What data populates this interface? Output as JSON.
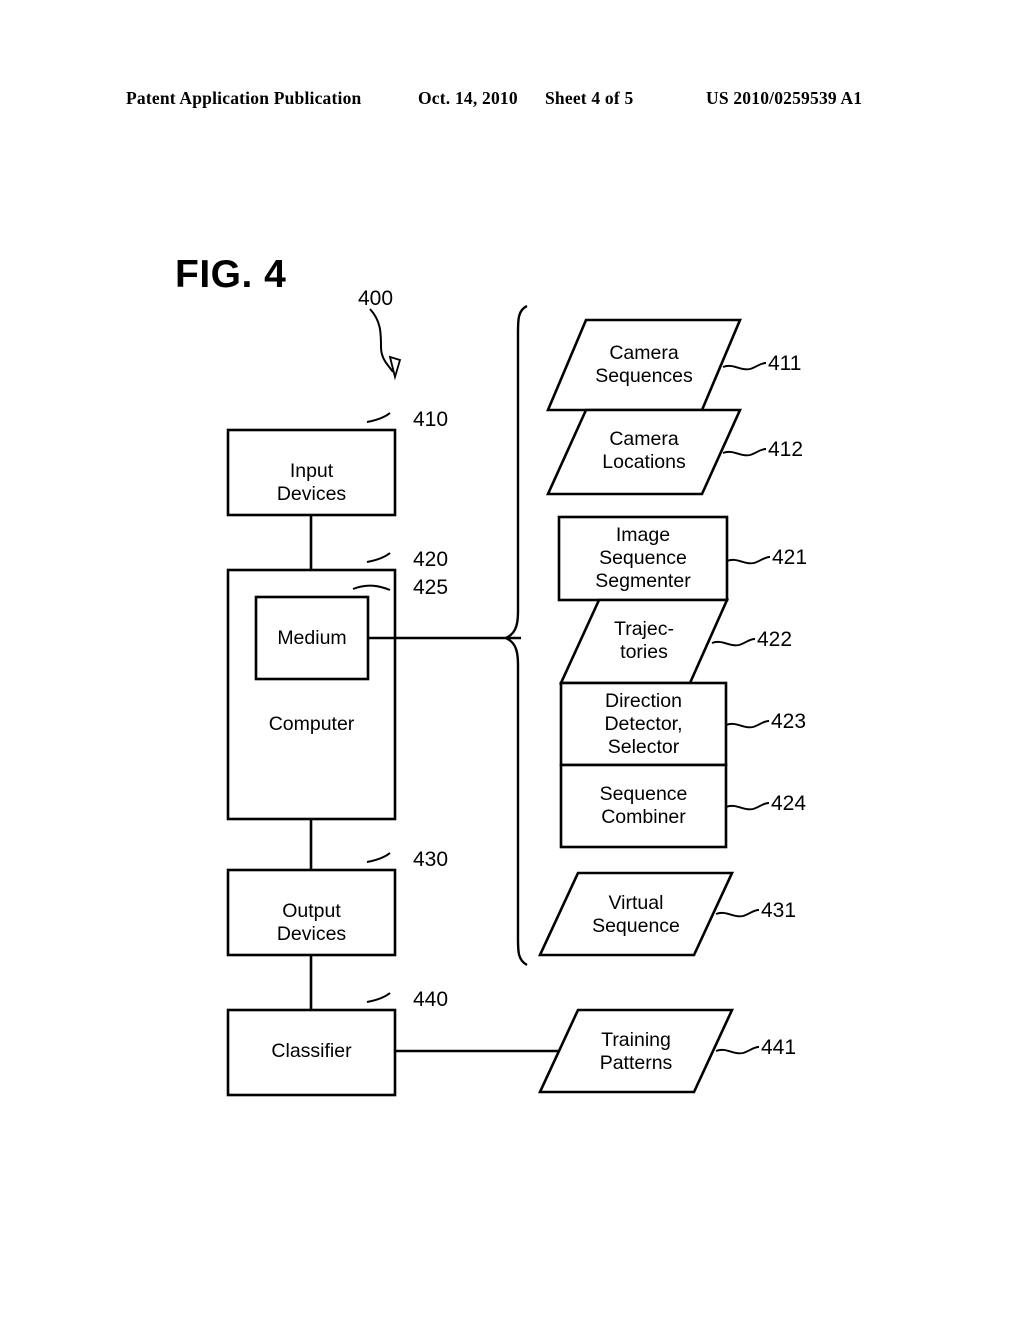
{
  "header": {
    "publication": "Patent Application Publication",
    "date": "Oct. 14, 2010",
    "sheet": "Sheet 4 of 5",
    "number": "US 2010/0259539 A1"
  },
  "figure": {
    "title": "FIG. 4",
    "system_ref": "400"
  },
  "colors": {
    "stroke": "#000000",
    "background": "#ffffff"
  },
  "left_column": {
    "nodes": [
      {
        "id": "input-devices",
        "label": "Input\nDevices",
        "ref": "410",
        "shape": "rectangle"
      },
      {
        "id": "computer",
        "label": "Computer",
        "ref": "420",
        "shape": "rectangle"
      },
      {
        "id": "medium",
        "label": "Medium",
        "ref": "425",
        "shape": "rectangle"
      },
      {
        "id": "output-devices",
        "label": "Output\nDevices",
        "ref": "430",
        "shape": "rectangle"
      },
      {
        "id": "classifier",
        "label": "Classifier",
        "ref": "440",
        "shape": "rectangle"
      }
    ]
  },
  "right_column": {
    "nodes": [
      {
        "id": "camera-sequences",
        "label": "Camera\nSequences",
        "ref": "411",
        "shape": "parallelogram"
      },
      {
        "id": "camera-locations",
        "label": "Camera\nLocations",
        "ref": "412",
        "shape": "parallelogram"
      },
      {
        "id": "image-sequence-segmenter",
        "label": "Image\nSequence\nSegmenter",
        "ref": "421",
        "shape": "rectangle"
      },
      {
        "id": "trajectories",
        "label": "Trajec-\ntories",
        "ref": "422",
        "shape": "parallelogram"
      },
      {
        "id": "direction-detector",
        "label": "Direction\nDetector,\nSelector",
        "ref": "423",
        "shape": "rectangle"
      },
      {
        "id": "sequence-combiner",
        "label": "Sequence\nCombiner",
        "ref": "424",
        "shape": "rectangle"
      },
      {
        "id": "virtual-sequence",
        "label": "Virtual\nSequence",
        "ref": "431",
        "shape": "parallelogram"
      },
      {
        "id": "training-patterns",
        "label": "Training\nPatterns",
        "ref": "441",
        "shape": "parallelogram"
      }
    ]
  }
}
